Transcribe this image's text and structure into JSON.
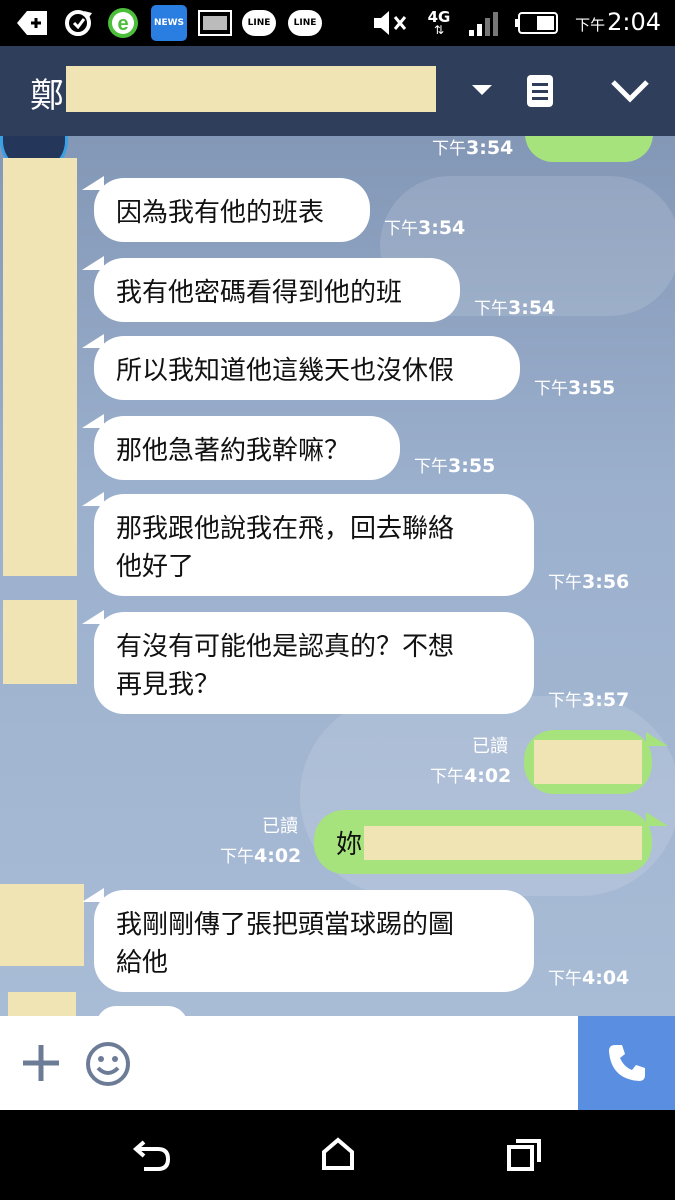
{
  "status_bar": {
    "news_label": "NEWS",
    "line_label_1": "LINE",
    "line_label_2": "LINE",
    "network": "4G",
    "time_prefix": "下午",
    "time": "2:04"
  },
  "header": {
    "title": "鄭"
  },
  "messages": [
    {
      "side": "right",
      "text": "",
      "time_prefix": "下午",
      "time": "3:54"
    },
    {
      "side": "left",
      "text": "因為我有他的班表",
      "time_prefix": "下午",
      "time": "3:54"
    },
    {
      "side": "left",
      "text": "我有他密碼看得到他的班",
      "time_prefix": "下午",
      "time": "3:54"
    },
    {
      "side": "left",
      "text": "所以我知道他這幾天也沒休假",
      "time_prefix": "下午",
      "time": "3:55"
    },
    {
      "side": "left",
      "text": "那他急著約我幹嘛？",
      "time_prefix": "下午",
      "time": "3:55"
    },
    {
      "side": "left",
      "text_line1": "那我跟他說我在飛，回去聯絡",
      "text_line2": "他好了",
      "time_prefix": "下午",
      "time": "3:56"
    },
    {
      "side": "left",
      "text_line1": "有沒有可能他是認真的？不想",
      "text_line2": "再見我？",
      "time_prefix": "下午",
      "time": "3:57"
    },
    {
      "side": "right",
      "read": "已讀",
      "text": "",
      "time_prefix": "下午",
      "time": "4:02"
    },
    {
      "side": "right",
      "read": "已讀",
      "text": "妳",
      "time_prefix": "下午",
      "time": "4:02"
    },
    {
      "side": "left",
      "text_line1": "我剛剛傳了張把頭當球踢的圖",
      "text_line2": "給他",
      "time_prefix": "下午",
      "time": "4:04"
    }
  ],
  "colors": {
    "header_bg": "#2f3e5a",
    "my_bubble": "#a6e37d",
    "their_bubble": "#ffffff",
    "call_button": "#5a8ee0",
    "redaction": "#f0e4b4"
  },
  "icons": {
    "add": "plus-icon",
    "emoji": "smiley-icon",
    "call": "phone-icon",
    "back": "back-icon",
    "home": "home-icon",
    "recents": "recents-icon"
  }
}
